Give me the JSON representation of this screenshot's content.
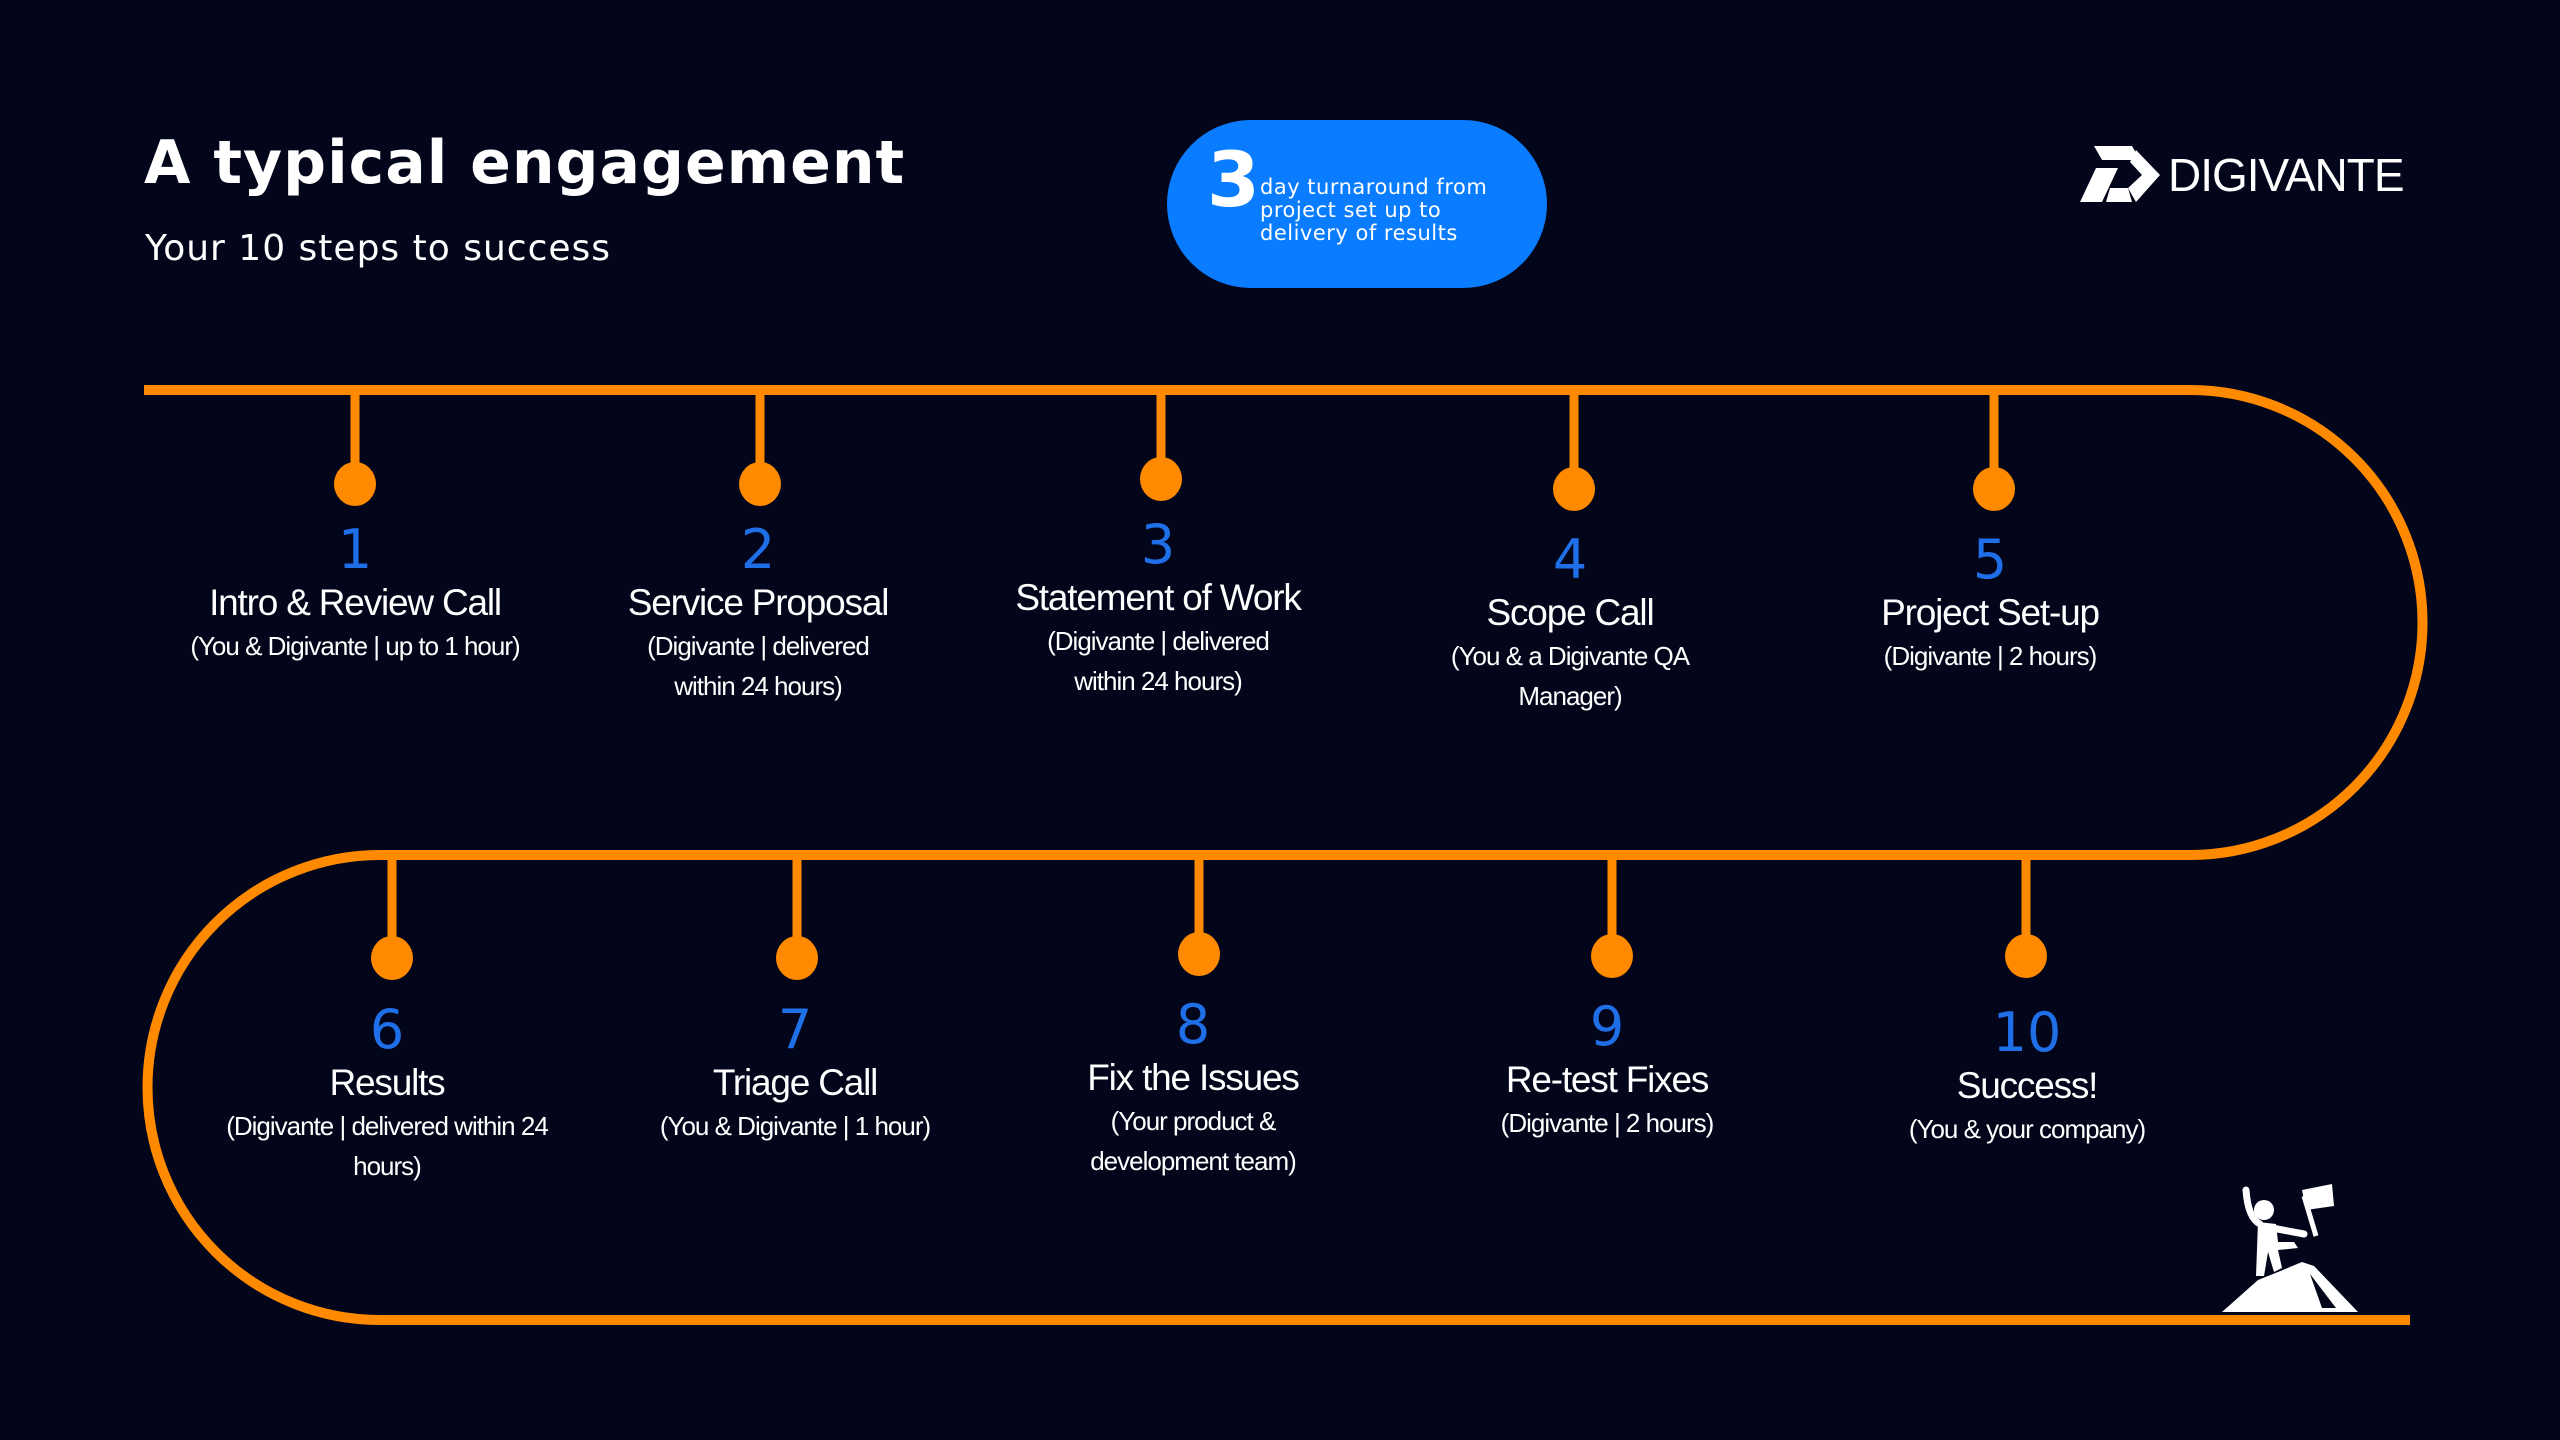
{
  "header": {
    "title": "A typical engagement",
    "subtitle": "Your 10 steps to success"
  },
  "badge": {
    "number": "3",
    "text": "day turnaround from project set up to delivery of results",
    "color": "#0a7cff"
  },
  "logo": {
    "icon": "digivante-d-logo-icon",
    "text": "DIGIVANTE"
  },
  "colors": {
    "background": "#03051a",
    "track": "#ff8a00",
    "step_number": "#1f6fe8",
    "text": "#ffffff"
  },
  "steps": [
    {
      "number": "1",
      "title": "Intro & Review Call",
      "description": "(You & Digivante | up to 1 hour)"
    },
    {
      "number": "2",
      "title": "Service Proposal",
      "description": "(Digivante | delivered within 24 hours)"
    },
    {
      "number": "3",
      "title": "Statement of Work",
      "description": "(Digivante | delivered within 24 hours)"
    },
    {
      "number": "4",
      "title": "Scope Call",
      "description": "(You & a Digivante QA Manager)"
    },
    {
      "number": "5",
      "title": "Project Set-up",
      "description": "(Digivante | 2 hours)"
    },
    {
      "number": "6",
      "title": "Results",
      "description": "(Digivante | delivered within 24 hours)"
    },
    {
      "number": "7",
      "title": "Triage Call",
      "description": "(You & Digivante | 1 hour)"
    },
    {
      "number": "8",
      "title": "Fix the Issues",
      "description": "(Your product & development team)"
    },
    {
      "number": "9",
      "title": "Re-test Fixes",
      "description": "(Digivante | 2 hours)"
    },
    {
      "number": "10",
      "title": "Success!",
      "description": "(You & your company)"
    }
  ],
  "end_icon": "climber-with-flag-on-summit-icon"
}
